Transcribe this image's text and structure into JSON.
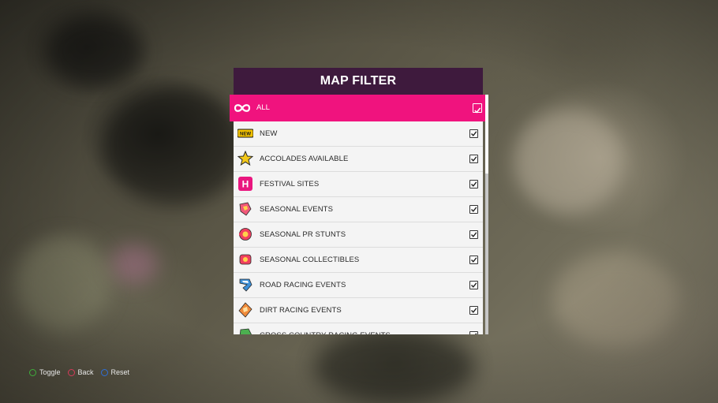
{
  "panel": {
    "title": "MAP FILTER"
  },
  "all_row": {
    "label": "ALL",
    "checked": true
  },
  "items": [
    {
      "label": "NEW",
      "icon": "new-badge-icon",
      "checked": true
    },
    {
      "label": "ACCOLADES AVAILABLE",
      "icon": "star-icon",
      "checked": true
    },
    {
      "label": "FESTIVAL SITES",
      "icon": "festival-h-icon",
      "checked": true
    },
    {
      "label": "SEASONAL EVENTS",
      "icon": "seasonal-event-icon",
      "checked": true
    },
    {
      "label": "SEASONAL PR STUNTS",
      "icon": "seasonal-pr-stunt-icon",
      "checked": true
    },
    {
      "label": "SEASONAL COLLECTIBLES",
      "icon": "seasonal-collectible-icon",
      "checked": true
    },
    {
      "label": "ROAD RACING EVENTS",
      "icon": "road-racing-icon",
      "checked": true
    },
    {
      "label": "DIRT RACING EVENTS",
      "icon": "dirt-racing-icon",
      "checked": true
    },
    {
      "label": "CROSS COUNTRY RACING EVENTS",
      "icon": "cross-country-icon",
      "checked": true
    }
  ],
  "new_badge_text": "NEW",
  "festival_letter": "H",
  "hints": [
    {
      "label": "Toggle",
      "button": "A",
      "color": "#3fae3c"
    },
    {
      "label": "Back",
      "button": "B",
      "color": "#d63a5a"
    },
    {
      "label": "Reset",
      "button": "X",
      "color": "#2e6fd8"
    }
  ],
  "colors": {
    "accent": "#f0137e",
    "header": "#3e1a3d",
    "row_bg": "#f4f4f4"
  }
}
